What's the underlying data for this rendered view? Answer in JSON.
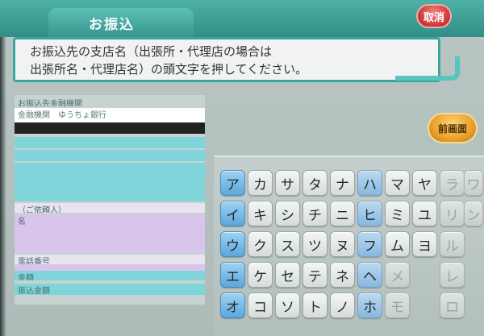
{
  "header": {
    "title": "お振込",
    "cancel_label": "取消"
  },
  "instruction": {
    "line1": "お振込先の支店名（出張所・代理店の場合は",
    "line2": "出張所名・代理店名）の頭文字を押してください。"
  },
  "info_panel": {
    "rows": [
      {
        "label": "お振込先金融機関",
        "color": "#c7d3d1"
      },
      {
        "label": "金融機関　ゆうちょ銀行",
        "color": "#ffffff"
      },
      {
        "label": "",
        "color": "#222222"
      },
      {
        "label": "",
        "color": "#7fd5da"
      },
      {
        "label": "",
        "color": "#7fd5da"
      },
      {
        "label": "",
        "color": "#7fd5da"
      },
      {
        "label": "依頼人",
        "color": "#d9c4ea"
      },
      {
        "label": "",
        "color": "#d9c4ea"
      },
      {
        "label": "",
        "color": "#d9c4ea"
      },
      {
        "label": "",
        "color": "#d9c4ea"
      },
      {
        "label": "",
        "color": "#7fd5da"
      },
      {
        "label": "",
        "color": "#7fd5da"
      }
    ],
    "requester_label": "（ご依頼人）",
    "name_label": "名",
    "phone_label": "電話番号",
    "amount_label": "金額",
    "fee_label": "振込金額"
  },
  "prev_screen_label": "前画面",
  "keyboard": {
    "rows": [
      [
        "ア",
        "カ",
        "サ",
        "タ",
        "ナ",
        "ハ",
        "マ",
        "ヤ",
        "ラ",
        "ワ"
      ],
      [
        "イ",
        "キ",
        "シ",
        "チ",
        "ニ",
        "ヒ",
        "ミ",
        "ユ",
        "リ",
        "ン"
      ],
      [
        "ウ",
        "ク",
        "ス",
        "ツ",
        "ヌ",
        "フ",
        "ム",
        "ヨ",
        "ル",
        ""
      ],
      [
        "エ",
        "ケ",
        "セ",
        "テ",
        "ネ",
        "ヘ",
        "メ",
        "",
        "レ",
        ""
      ],
      [
        "オ",
        "コ",
        "ソ",
        "ト",
        "ノ",
        "ホ",
        "モ",
        "",
        "ロ",
        ""
      ]
    ]
  },
  "colors": {
    "accent": "#3aa59b",
    "vowel_key": "#5aa7dc",
    "cancel": "#d43d3d",
    "prev": "#e9a22a"
  }
}
